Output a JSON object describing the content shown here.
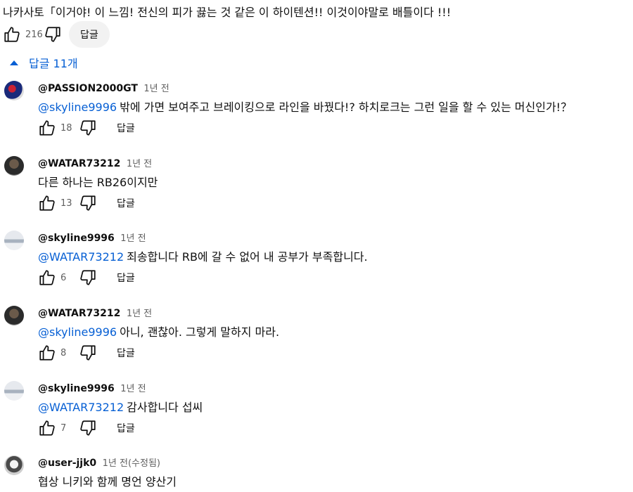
{
  "top_comment": {
    "text": "나카사토「이거야! 이 느낌! 전신의 피가 끓는 것 같은 이 하이텐션!! 이것이야말로 배틀이다 !!!",
    "likes": "216",
    "reply_label": "답글"
  },
  "replies_toggle": {
    "label": "답글 11개",
    "icon": "chevron-up-icon"
  },
  "replies": [
    {
      "author": "@PASSION2000GT",
      "time": "1년 전",
      "mention": "@skyline9996",
      "text": "밖에 가면 보여주고 브레이킹으로 라인을 바꿨다!? 하치로크는 그런 일을 할 수 있는 머신인가!？",
      "likes": "18",
      "reply_label": "답글"
    },
    {
      "author": "@WATAR73212",
      "time": "1년 전",
      "mention": "",
      "text": "다른 하나는 RB26이지만",
      "likes": "13",
      "reply_label": "답글"
    },
    {
      "author": "@skyline9996",
      "time": "1년 전",
      "mention": "@WATAR73212",
      "text": "죄송합니다 RB에 갈 수 없어 내 공부가 부족합니다.",
      "likes": "6",
      "reply_label": "답글"
    },
    {
      "author": "@WATAR73212",
      "time": "1년 전",
      "mention": "@skyline9996",
      "text": "아니, 괜찮아. 그렇게 말하지 마라.",
      "likes": "8",
      "reply_label": "답글"
    },
    {
      "author": "@skyline9996",
      "time": "1년 전",
      "mention": "@WATAR73212",
      "text": "감사합니다 섭씨",
      "likes": "7",
      "reply_label": "답글"
    },
    {
      "author": "@user-jjk0",
      "time": "1년 전(수정됨)",
      "mention": "",
      "text": "협상 니키와 함께 명언 양산기"
    }
  ],
  "colors": {
    "link": "#065fd4",
    "muted": "#606060",
    "pill_bg": "#f2f2f2"
  }
}
